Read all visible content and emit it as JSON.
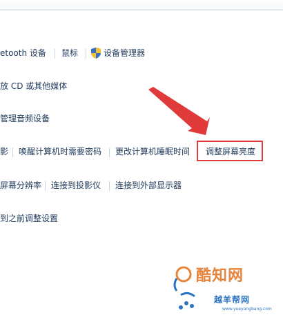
{
  "rows": [
    {
      "items": [
        "etooth 设备",
        "鼠标",
        "设备管理器"
      ]
    },
    {
      "items": [
        "放 CD 或其他媒体"
      ]
    },
    {
      "items": [
        "管理音频设备"
      ]
    },
    {
      "items": [
        "影",
        "唤醒计算机时需要密码",
        "更改计算机睡眠时间",
        "调整屏幕亮度"
      ]
    },
    {
      "items": [
        "屏幕分辨率",
        "连接到投影仪",
        "连接到外部显示器"
      ]
    },
    {
      "items": [
        "到之前调整设置"
      ]
    }
  ],
  "watermark": {
    "main": "酷知网",
    "sub": "越羊帮网",
    "url": "www.yueyangbang.com"
  },
  "icons": {
    "device_manager": "uac-shield-icon"
  },
  "colors": {
    "link": "#1e395b",
    "highlight": "#e03a3a",
    "watermark_orange": "#e8843a",
    "watermark_blue": "#2b74c2"
  }
}
